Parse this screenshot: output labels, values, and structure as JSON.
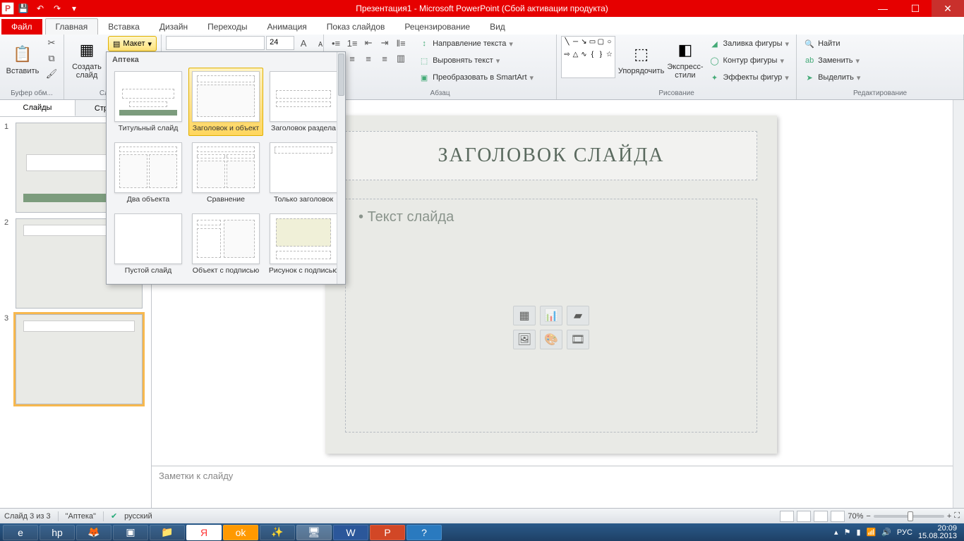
{
  "app": {
    "title": "Презентация1 - Microsoft PowerPoint (Сбой активации продукта)"
  },
  "tabs": {
    "file": "Файл",
    "items": [
      "Главная",
      "Вставка",
      "Дизайн",
      "Переходы",
      "Анимация",
      "Показ слайдов",
      "Рецензирование",
      "Вид"
    ],
    "active": 0
  },
  "ribbon": {
    "clipboard": {
      "paste": "Вставить",
      "label": "Буфер обм..."
    },
    "slides": {
      "new": "Создать\nслайд",
      "layout": "Макет",
      "label": "Слайды"
    },
    "font_size": "24",
    "paragraph": {
      "label": "Абзац",
      "text_direction": "Направление текста",
      "align_text": "Выровнять текст",
      "smartart": "Преобразовать в SmartArt"
    },
    "drawing": {
      "arrange": "Упорядочить",
      "quick_styles": "Экспресс-стили",
      "fill": "Заливка фигуры",
      "outline": "Контур фигуры",
      "effects": "Эффекты фигур",
      "label": "Рисование"
    },
    "editing": {
      "find": "Найти",
      "replace": "Заменить",
      "select": "Выделить",
      "label": "Редактирование"
    }
  },
  "layout_panel": {
    "header": "Аптека",
    "items": [
      "Титульный слайд",
      "Заголовок и объект",
      "Заголовок раздела",
      "Два объекта",
      "Сравнение",
      "Только заголовок",
      "Пустой слайд",
      "Объект с подписью",
      "Рисунок с подписью"
    ],
    "selected": 1
  },
  "panel": {
    "tab_slides": "Слайды",
    "tab_outline": "Структура"
  },
  "slide": {
    "title_placeholder": "ЗАГОЛОВОК СЛАЙДА",
    "body_placeholder": "Текст слайда"
  },
  "notes": "Заметки к слайду",
  "status": {
    "slide": "Слайд 3 из 3",
    "theme": "\"Аптека\"",
    "lang": "русский",
    "zoom": "70%"
  },
  "tray": {
    "lang": "РУС",
    "time": "20:09",
    "date": "15.08.2013"
  }
}
